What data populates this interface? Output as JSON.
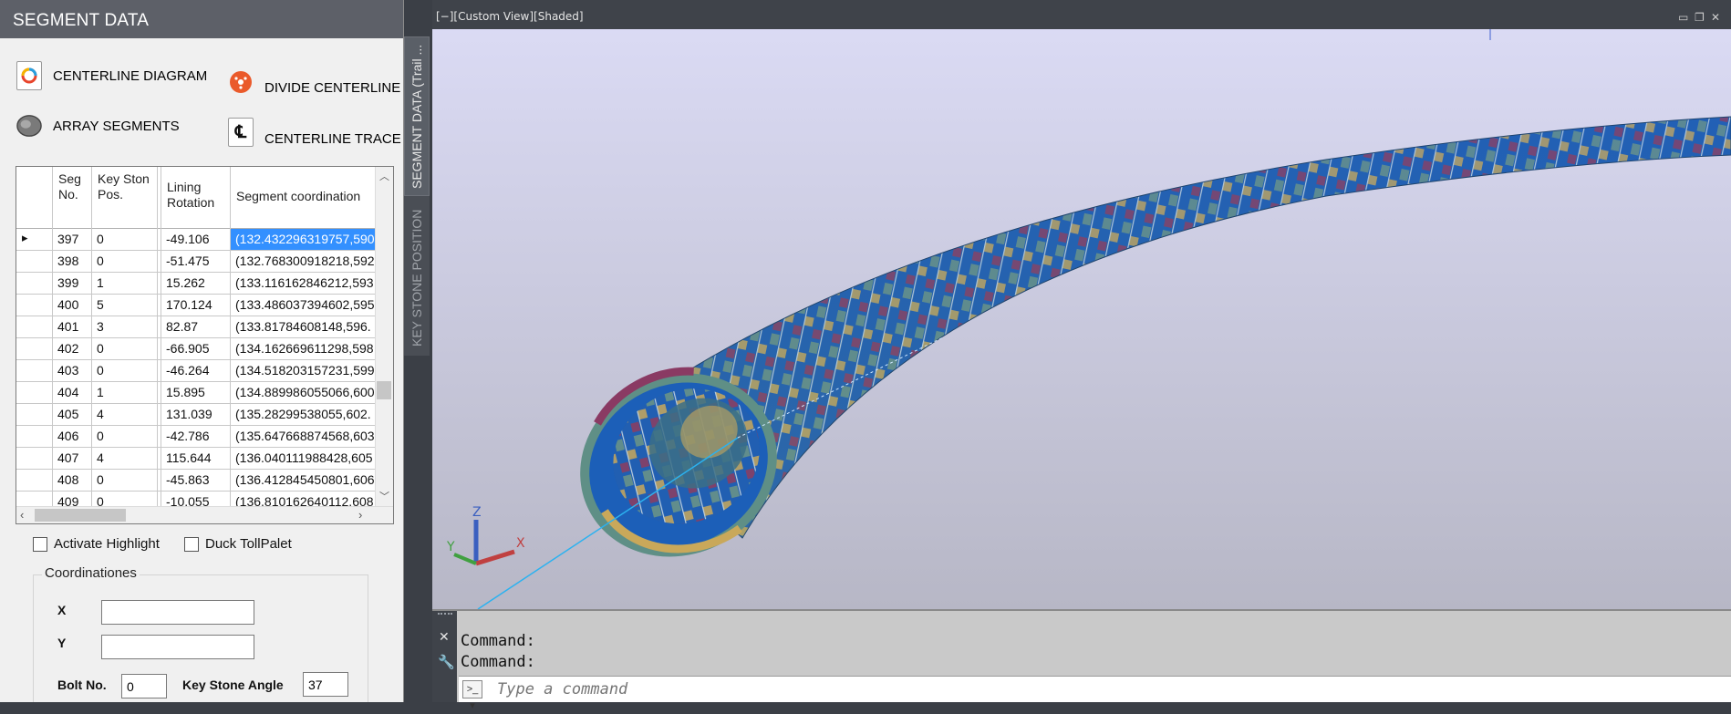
{
  "palette": {
    "title": "SEGMENT DATA",
    "tools": {
      "centerline_diagram": "CENTERLINE DIAGRAM",
      "divide_centerline": "DIVIDE CENTERLINE",
      "array_segments": "ARRAY SEGMENTS",
      "centerline_trace": "CENTERLINE TRACE"
    },
    "grid": {
      "columns": [
        "Seg No.",
        "Key Ston Pos.",
        "",
        "Lining Rotation",
        "Segment coordination"
      ],
      "rows": [
        {
          "seg": "397",
          "key": "0",
          "rot": "-49.106",
          "coord": "(132.432296319757,590"
        },
        {
          "seg": "398",
          "key": "0",
          "rot": "-51.475",
          "coord": "(132.768300918218,592"
        },
        {
          "seg": "399",
          "key": "1",
          "rot": "15.262",
          "coord": "(133.116162846212,593"
        },
        {
          "seg": "400",
          "key": "5",
          "rot": "170.124",
          "coord": "(133.486037394602,595"
        },
        {
          "seg": "401",
          "key": "3",
          "rot": "82.87",
          "coord": "(133.81784608148,596."
        },
        {
          "seg": "402",
          "key": "0",
          "rot": "-66.905",
          "coord": "(134.162669611298,598"
        },
        {
          "seg": "403",
          "key": "0",
          "rot": "-46.264",
          "coord": "(134.518203157231,599"
        },
        {
          "seg": "404",
          "key": "1",
          "rot": "15.895",
          "coord": "(134.889986055066,600"
        },
        {
          "seg": "405",
          "key": "4",
          "rot": "131.039",
          "coord": "(135.28299538055,602."
        },
        {
          "seg": "406",
          "key": "0",
          "rot": "-42.786",
          "coord": "(135.647668874568,603"
        },
        {
          "seg": "407",
          "key": "4",
          "rot": "115.644",
          "coord": "(136.040111988428,605"
        },
        {
          "seg": "408",
          "key": "0",
          "rot": "-45.863",
          "coord": "(136.412845450801,606"
        },
        {
          "seg": "409",
          "key": "0",
          "rot": "-10.055",
          "coord": "(136.810162640112,608"
        }
      ]
    },
    "activate_highlight": "Activate Highlight",
    "duck_toolpalet": "Duck TollPalet",
    "coordinations": {
      "legend": "Coordinationes",
      "x_label": "X",
      "x_value": "",
      "y_label": "Y",
      "y_value": "",
      "bolt_label": "Bolt No.",
      "bolt_value": "0",
      "keystone_label": "Key Stone Angle",
      "keystone_value": "37"
    },
    "side_tabs": {
      "segment": "SEGMENT DATA (Trail ...",
      "keystone": "KEY STONE POSITION"
    }
  },
  "viewport": {
    "label": "[−][Custom View][Shaded]",
    "axes": {
      "x": "X",
      "y": "Y",
      "z": "Z"
    },
    "colors": {
      "blue": "#1c5fb8",
      "teal": "#5f8f86",
      "gold": "#c9a85a",
      "maroon": "#8a3a63"
    }
  },
  "command": {
    "history": [
      "Command:",
      "Command:"
    ],
    "placeholder": "Type a command",
    "prompt_icon": ">_ ▾"
  }
}
